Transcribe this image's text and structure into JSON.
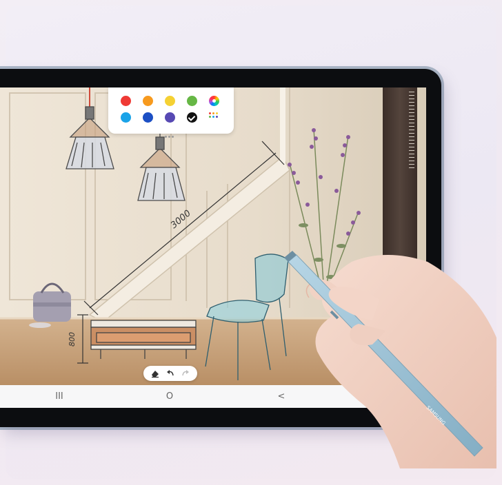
{
  "screen": {
    "colors": {
      "wall": "#e9dfd0",
      "floor": "#c9a27a",
      "nav_bg": "#f7f7f8",
      "tablet_bezel": "#0c0d10"
    }
  },
  "palette": {
    "swatches": [
      {
        "name": "red",
        "color": "#ef3a35",
        "selected": false
      },
      {
        "name": "orange",
        "color": "#f79a1e",
        "selected": false
      },
      {
        "name": "yellow",
        "color": "#f5d133",
        "selected": false
      },
      {
        "name": "green",
        "color": "#66b745",
        "selected": false
      },
      {
        "name": "sky-blue",
        "color": "#1aa3e8",
        "selected": false
      },
      {
        "name": "blue",
        "color": "#1c4fc4",
        "selected": false
      },
      {
        "name": "indigo",
        "color": "#5749b3",
        "selected": false
      },
      {
        "name": "black",
        "color": "#111111",
        "selected": true
      }
    ],
    "extra_icons": [
      "color-spectrum-icon",
      "color-grid-icon"
    ]
  },
  "sketch": {
    "dimension_top": "3000",
    "dimension_side": "800"
  },
  "edit_toolbar": {
    "icons": [
      "eraser-icon",
      "undo-icon",
      "redo-icon"
    ]
  },
  "navbar": {
    "recents": "III",
    "home": "O",
    "back": "<"
  },
  "pen": {
    "brand": "SAMSUNG",
    "color": "#9ec4d8"
  }
}
